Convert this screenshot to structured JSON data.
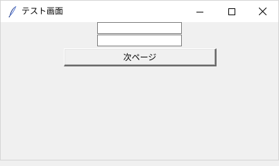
{
  "window": {
    "title": "テスト画面",
    "icon": "feather-icon",
    "controls": {
      "minimize_icon": "minimize-icon",
      "maximize_icon": "maximize-icon",
      "close_icon": "close-icon"
    }
  },
  "form": {
    "field1_value": "",
    "field2_value": "",
    "next_button_label": "次ページ"
  },
  "colors": {
    "background": "#f0f0f0",
    "titlebar": "#ffffff",
    "entry_border": "#7a7a7a"
  }
}
